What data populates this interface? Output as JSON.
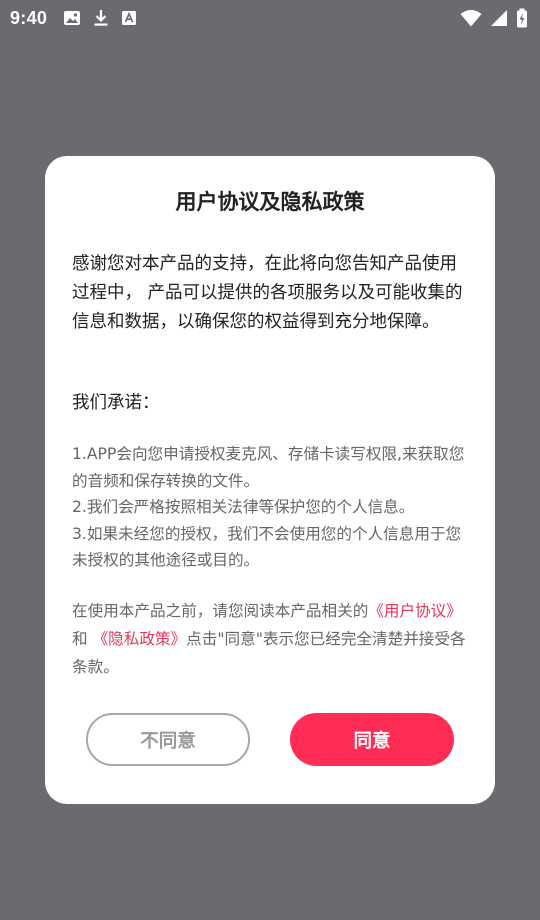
{
  "status_bar": {
    "time": "9:40",
    "left_icons": [
      "image-icon",
      "download-icon",
      "font-icon"
    ],
    "right_icons": [
      "wifi-icon",
      "signal-icon",
      "battery-charging-icon"
    ]
  },
  "dialog": {
    "title": "用户协议及隐私政策",
    "intro": "感谢您对本产品的支持，在此将向您告知产品使用过程中， 产品可以提供的各项服务以及可能收集的信息和数据，以确保您的权益得到充分地保障。",
    "promise_heading": "我们承诺：",
    "promises": [
      "1.APP会向您申请授权麦克风、存储卡读写权限,来获取您的音频和保存转换的文件。",
      "2.我们会严格按照相关法律等保护您的个人信息。",
      "3.如果未经您的授权，我们不会使用您的个人信息用于您未授权的其他途径或目的。"
    ],
    "policy": {
      "prefix": "在使用本产品之前，请您阅读本产品相关的",
      "user_agreement_link": "《用户协议》",
      "and": "和 ",
      "privacy_policy_link": "《隐私政策》",
      "suffix": "点击\"同意\"表示您已经完全清楚并接受各条款。"
    },
    "buttons": {
      "disagree": "不同意",
      "agree": "同意"
    }
  },
  "colors": {
    "overlay": "#696b6e",
    "accent": "#ff2d55",
    "link": "#e8365a"
  }
}
